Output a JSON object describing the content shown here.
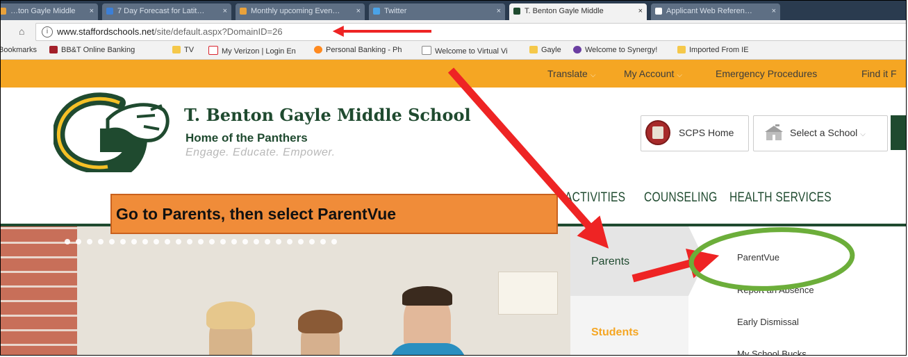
{
  "browser": {
    "tabs": [
      {
        "label": "…ton Gayle Middle"
      },
      {
        "label": "7 Day Forecast for Latit…"
      },
      {
        "label": "Monthly upcoming Even…"
      },
      {
        "label": "Twitter"
      },
      {
        "label": "T. Benton Gayle Middle"
      },
      {
        "label": "Applicant Web Referen…"
      }
    ],
    "url_host": "www.staffordschools.net",
    "url_path": "/site/default.aspx?DomainID=26",
    "bookmarks": [
      {
        "label": "Bookmarks",
        "color": "#f2f2f2"
      },
      {
        "label": "BB&T Online Banking",
        "color": "#a3202a"
      },
      {
        "label": "TV",
        "color": "#f5c84a"
      },
      {
        "label": "My Verizon | Login En",
        "color": "#d9232d"
      },
      {
        "label": "Personal Banking - Ph",
        "color": "#ff8a1f"
      },
      {
        "label": "Welcome to Virtual Vi",
        "color": "#ffffff"
      },
      {
        "label": "Gayle",
        "color": "#f5c84a"
      },
      {
        "label": "Welcome to Synergy!",
        "color": "#6a3ea1"
      },
      {
        "label": "Imported From IE",
        "color": "#f5c84a"
      }
    ]
  },
  "site": {
    "utility": {
      "translate": "Translate",
      "my_account": "My Account",
      "emergency": "Emergency Procedures",
      "find_it": "Find it F"
    },
    "school_name": "T. Benton Gayle Middle School",
    "tagline": "Home of the Panthers",
    "motto": "Engage. Educate. Empower.",
    "scps_home": "SCPS Home",
    "select_school": "Select a School",
    "nav": {
      "activities": "ACTIVITIES",
      "counseling": "COUNSELING",
      "health": "HEALTH SERVICES"
    },
    "menu": {
      "parents": "Parents",
      "students": "Students",
      "links": [
        "ParentVue",
        "Report an Absence",
        "Early Dismissal",
        "My School Bucks"
      ]
    }
  },
  "annotation": {
    "callout": "Go to Parents, then select ParentVue"
  },
  "colors": {
    "brand_green": "#1f4a2f",
    "brand_orange": "#f5a623",
    "arrow_red": "#ee2424",
    "circle_green": "#6cae3a"
  }
}
